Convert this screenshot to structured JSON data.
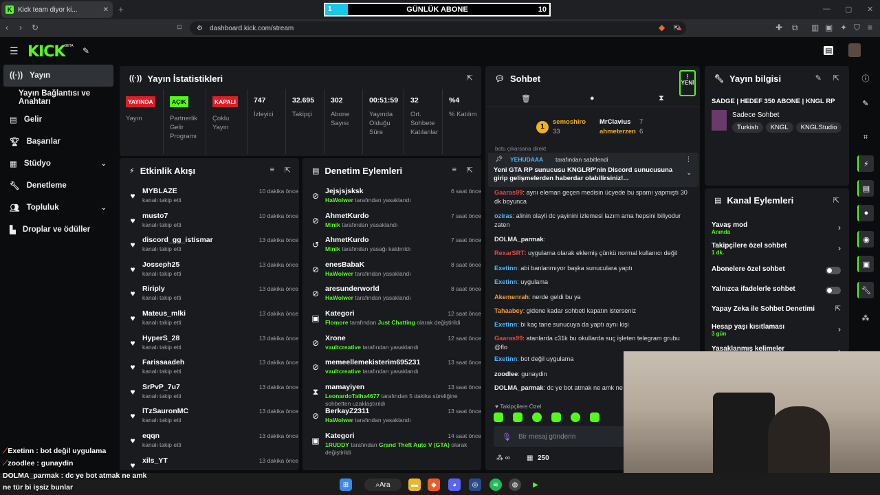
{
  "browser": {
    "tab_title": "Kick team diyor ki...",
    "url": "dashboard.kick.com/stream"
  },
  "overlay": {
    "left_num": "1",
    "title": "GÜNLÜK ABONE",
    "right_num": "10",
    "fill_fraction": 0.1
  },
  "kick": {
    "logo": "KICK",
    "beta": "BETA"
  },
  "sidebar": {
    "items": [
      {
        "label": "Yayın",
        "icon": "broadcast-icon"
      },
      {
        "label": "Yayın Bağlantısı ve Anahtarı",
        "icon": ""
      },
      {
        "label": "Gelir",
        "icon": "revenue-icon"
      },
      {
        "label": "Başarılar",
        "icon": "trophy-icon"
      },
      {
        "label": "Stüdyo",
        "icon": "studio-icon"
      },
      {
        "label": "Denetleme",
        "icon": "wrench-icon"
      },
      {
        "label": "Topluluk",
        "icon": "community-icon"
      },
      {
        "label": "Droplar ve ödüller",
        "icon": "drops-icon"
      }
    ]
  },
  "stats": {
    "title": "Yayın İstatistikleri",
    "cols": [
      {
        "badge": "YAYINDA",
        "label": "Yayın"
      },
      {
        "badge": "AÇIK",
        "label": "Partnerlik Gelir Programı"
      },
      {
        "badge": "KAPALI",
        "label": "Çoklu Yayın"
      },
      {
        "value": "747",
        "label": "İzleyici"
      },
      {
        "value": "32.695",
        "label": "Takipçi"
      },
      {
        "value": "302",
        "label": "Abone Sayısı"
      },
      {
        "value": "00:51:59",
        "label": "Yayında Olduğu Süre"
      },
      {
        "value": "32",
        "label": "Ort. Sohbete Katılanlar"
      },
      {
        "value": "%4",
        "label": "% Katılım"
      }
    ]
  },
  "activity": {
    "title": "Etkinlik Akışı",
    "items": [
      {
        "name": "MYBLAZE",
        "sub": "kanalı takip etti",
        "time": "10 dakika önce"
      },
      {
        "name": "musto7",
        "sub": "kanalı takip etti",
        "time": "10 dakika önce"
      },
      {
        "name": "discord_gg_istismar",
        "sub": "kanalı takip etti",
        "time": "13 dakika önce"
      },
      {
        "name": "Josseph25",
        "sub": "kanalı takip etti",
        "time": "13 dakika önce"
      },
      {
        "name": "Ririply",
        "sub": "kanalı takip etti",
        "time": "13 dakika önce"
      },
      {
        "name": "Mateus_mlki",
        "sub": "kanalı takip etti",
        "time": "13 dakika önce"
      },
      {
        "name": "HyperS_28",
        "sub": "kanalı takip etti",
        "time": "13 dakika önce"
      },
      {
        "name": "Farissaadeh",
        "sub": "kanalı takip etti",
        "time": "13 dakika önce"
      },
      {
        "name": "SrPvP_7u7",
        "sub": "kanalı takip etti",
        "time": "13 dakika önce"
      },
      {
        "name": "lTzSauronMC",
        "sub": "kanalı takip etti",
        "time": "13 dakika önce"
      },
      {
        "name": "eqqn",
        "sub": "kanalı takip etti",
        "time": "13 dakika önce"
      },
      {
        "name": "xils_YT",
        "sub": "",
        "time": "13 dakika önce"
      }
    ]
  },
  "moderation": {
    "title": "Denetim Eylemleri",
    "items": [
      {
        "name": "Jejsjsjsksk",
        "who": "HaWolwer",
        "sub": " tarafından yasaklandı",
        "time": "6 saat önce",
        "icon": "ban-icon"
      },
      {
        "name": "AhmetKurdo",
        "who": "Minik",
        "sub": " tarafından yasaklandı",
        "time": "7 saat önce",
        "icon": "ban-icon"
      },
      {
        "name": "AhmetKurdo",
        "who": "Minik",
        "sub": " tarafından yasağı kaldırıldı",
        "time": "7 saat önce",
        "icon": "undo-icon"
      },
      {
        "name": "enesBabaK",
        "who": "HaWolwer",
        "sub": " tarafından yasaklandı",
        "time": "8 saat önce",
        "icon": "ban-icon"
      },
      {
        "name": "aresunderworld",
        "who": "HaWolwer",
        "sub": " tarafından yasaklandı",
        "time": "8 saat önce",
        "icon": "ban-icon"
      },
      {
        "name": "Kategori",
        "who": "Flomore",
        "sub": " tarafından ",
        "extra": "Just Chatting",
        "extra2": " olarak değiştirildi",
        "time": "12 saat önce",
        "icon": "category-icon"
      },
      {
        "name": "Xrone",
        "who": "vaultcreative",
        "sub": " tarafından yasaklandı",
        "time": "12 saat önce",
        "icon": "ban-icon"
      },
      {
        "name": "memeellemekisterim695231",
        "who": "vaultcreative",
        "sub": " tarafından yasaklandı",
        "time": "13 saat önce",
        "icon": "ban-icon"
      },
      {
        "name": "mamayiyen",
        "who": "LeonardoTalha4677",
        "sub": " tarafından 5 dakika süreliğine",
        "line2": "sohbetten uzaklaştırıldı",
        "time": "13 saat önce",
        "icon": "timeout-icon"
      },
      {
        "name": "BerkayZ2311",
        "who": "HaWolwer",
        "sub": " tarafından yasaklandı",
        "time": "13 saat önce",
        "icon": "ban-icon"
      },
      {
        "name": "Kategori",
        "who": "1RUDDY",
        "sub": " tarafından ",
        "extra": "Grand Theft Auto V (GTA)",
        "extra2": " olarak",
        "line2": "değiştirildi",
        "time": "14 saat önce",
        "icon": "category-icon"
      }
    ]
  },
  "chat": {
    "title": "Sohbet",
    "new_label": "YENİ",
    "leader1": {
      "name": "semoshiro",
      "score": "33",
      "rank": "1"
    },
    "leader2": {
      "name": "MrClavius",
      "score": "7"
    },
    "leader3": {
      "name": "ahmeterzen",
      "score": "6"
    },
    "top_cut": "botu çıkarsana direkt",
    "pinned_by": "YEHUDAAA",
    "pinned_suffix": " tarafından sabitlendi",
    "pinned_text": "Yeni GTA RP sunucusu KNGLRP'nin Discord sunucusuna girip gelişmelerden haberdar olabilirsiniz!...",
    "messages": [
      {
        "name": "Gaaras99",
        "text": ": aynı eleman geçen medisin ücyede bu spamı yapmıştı 30 dk boyunca",
        "color": "#e04848"
      },
      {
        "name": "oziras",
        "text": ": alinin olayli dc yayinini izlemesi lazım ama hepsini biliyodur zaten",
        "color": "#4db8ff"
      },
      {
        "name": "DOLMA_parmak",
        "text": ":",
        "color": "#f0f0f0"
      },
      {
        "name": "RexarSRT",
        "text": ": uygulama olarak eklemiş çünkü normal kullanıcı değil",
        "color": "#e04848"
      },
      {
        "name": "Exetinn",
        "text": ": abi banlanmıyor başka sunuculara yaptı",
        "color": "#4db8ff"
      },
      {
        "name": "Exetinn",
        "text": ": uygulama",
        "color": "#4db8ff"
      },
      {
        "name": "Akemenrah",
        "text": ": nerde geldi bu ya",
        "color": "#f0a030"
      },
      {
        "name": "Tahaabey",
        "text": ": gidene kadar sohbeti kapatın isterseniz",
        "color": "#f0a030"
      },
      {
        "name": "Exetinn",
        "text": ": bi kaç tane sunucuya da yaptı aynı kişi",
        "color": "#4db8ff"
      },
      {
        "name": "Gaaras99",
        "text": ": atanlarda c31k bu okullarda suç işleten telegram grubu @flo",
        "color": "#e04848"
      },
      {
        "name": "Exetinn",
        "text": ": bot değil uygulama",
        "color": "#4db8ff"
      },
      {
        "name": "zoodlee",
        "text": ": gunaydin",
        "color": "#f0f0f0"
      },
      {
        "name": "DOLMA_parmak",
        "text": ": dc ye bot atmak ne amk ne t",
        "color": "#f0f0f0"
      }
    ],
    "followers_only": "Takipçilere Özel",
    "placeholder": "Bir mesaj gönderin",
    "points": "250"
  },
  "info": {
    "title": "Yayın bilgisi",
    "stream_title": "SADGE | HEDEF 350 ABONE | KNGL RP",
    "category": "Sadece Sohbet",
    "tags": [
      "Turkish",
      "KNGL",
      "KNGLStudio"
    ]
  },
  "actions": {
    "title": "Kanal Eylemleri",
    "rows": [
      {
        "label": "Yavaş mod",
        "sub": "Anında",
        "ctl": "chevron"
      },
      {
        "label": "Takipçilere özel sohbet",
        "sub": "1 dk.",
        "ctl": "chevron"
      },
      {
        "label": "Abonelere özel sohbet",
        "sub": "",
        "ctl": "toggle"
      },
      {
        "label": "Yalnızca ifadelerle sohbet",
        "sub": "",
        "ctl": "toggle"
      },
      {
        "label": "Yapay Zeka ile Sohbet Denetimi",
        "sub": "",
        "ctl": "link"
      },
      {
        "label": "Hesap yaşı kısıtlaması",
        "sub": "3 gün",
        "ctl": "chevron"
      },
      {
        "label": "Yasaklanmış kelimeler",
        "sub": "",
        "ctl": "chevron"
      }
    ]
  },
  "overlay_chat": [
    {
      "name": "Exetinn",
      "text": " : bot değil uygulama"
    },
    {
      "name": "zoodlee",
      "text": " : gunaydin"
    },
    {
      "name": "DOLMA_parmak",
      "text": " : dc ye bot atmak ne amk"
    },
    {
      "name": "",
      "text": "ne tür bi işsiz bunlar"
    }
  ],
  "taskbar": {
    "search": "Ara"
  }
}
